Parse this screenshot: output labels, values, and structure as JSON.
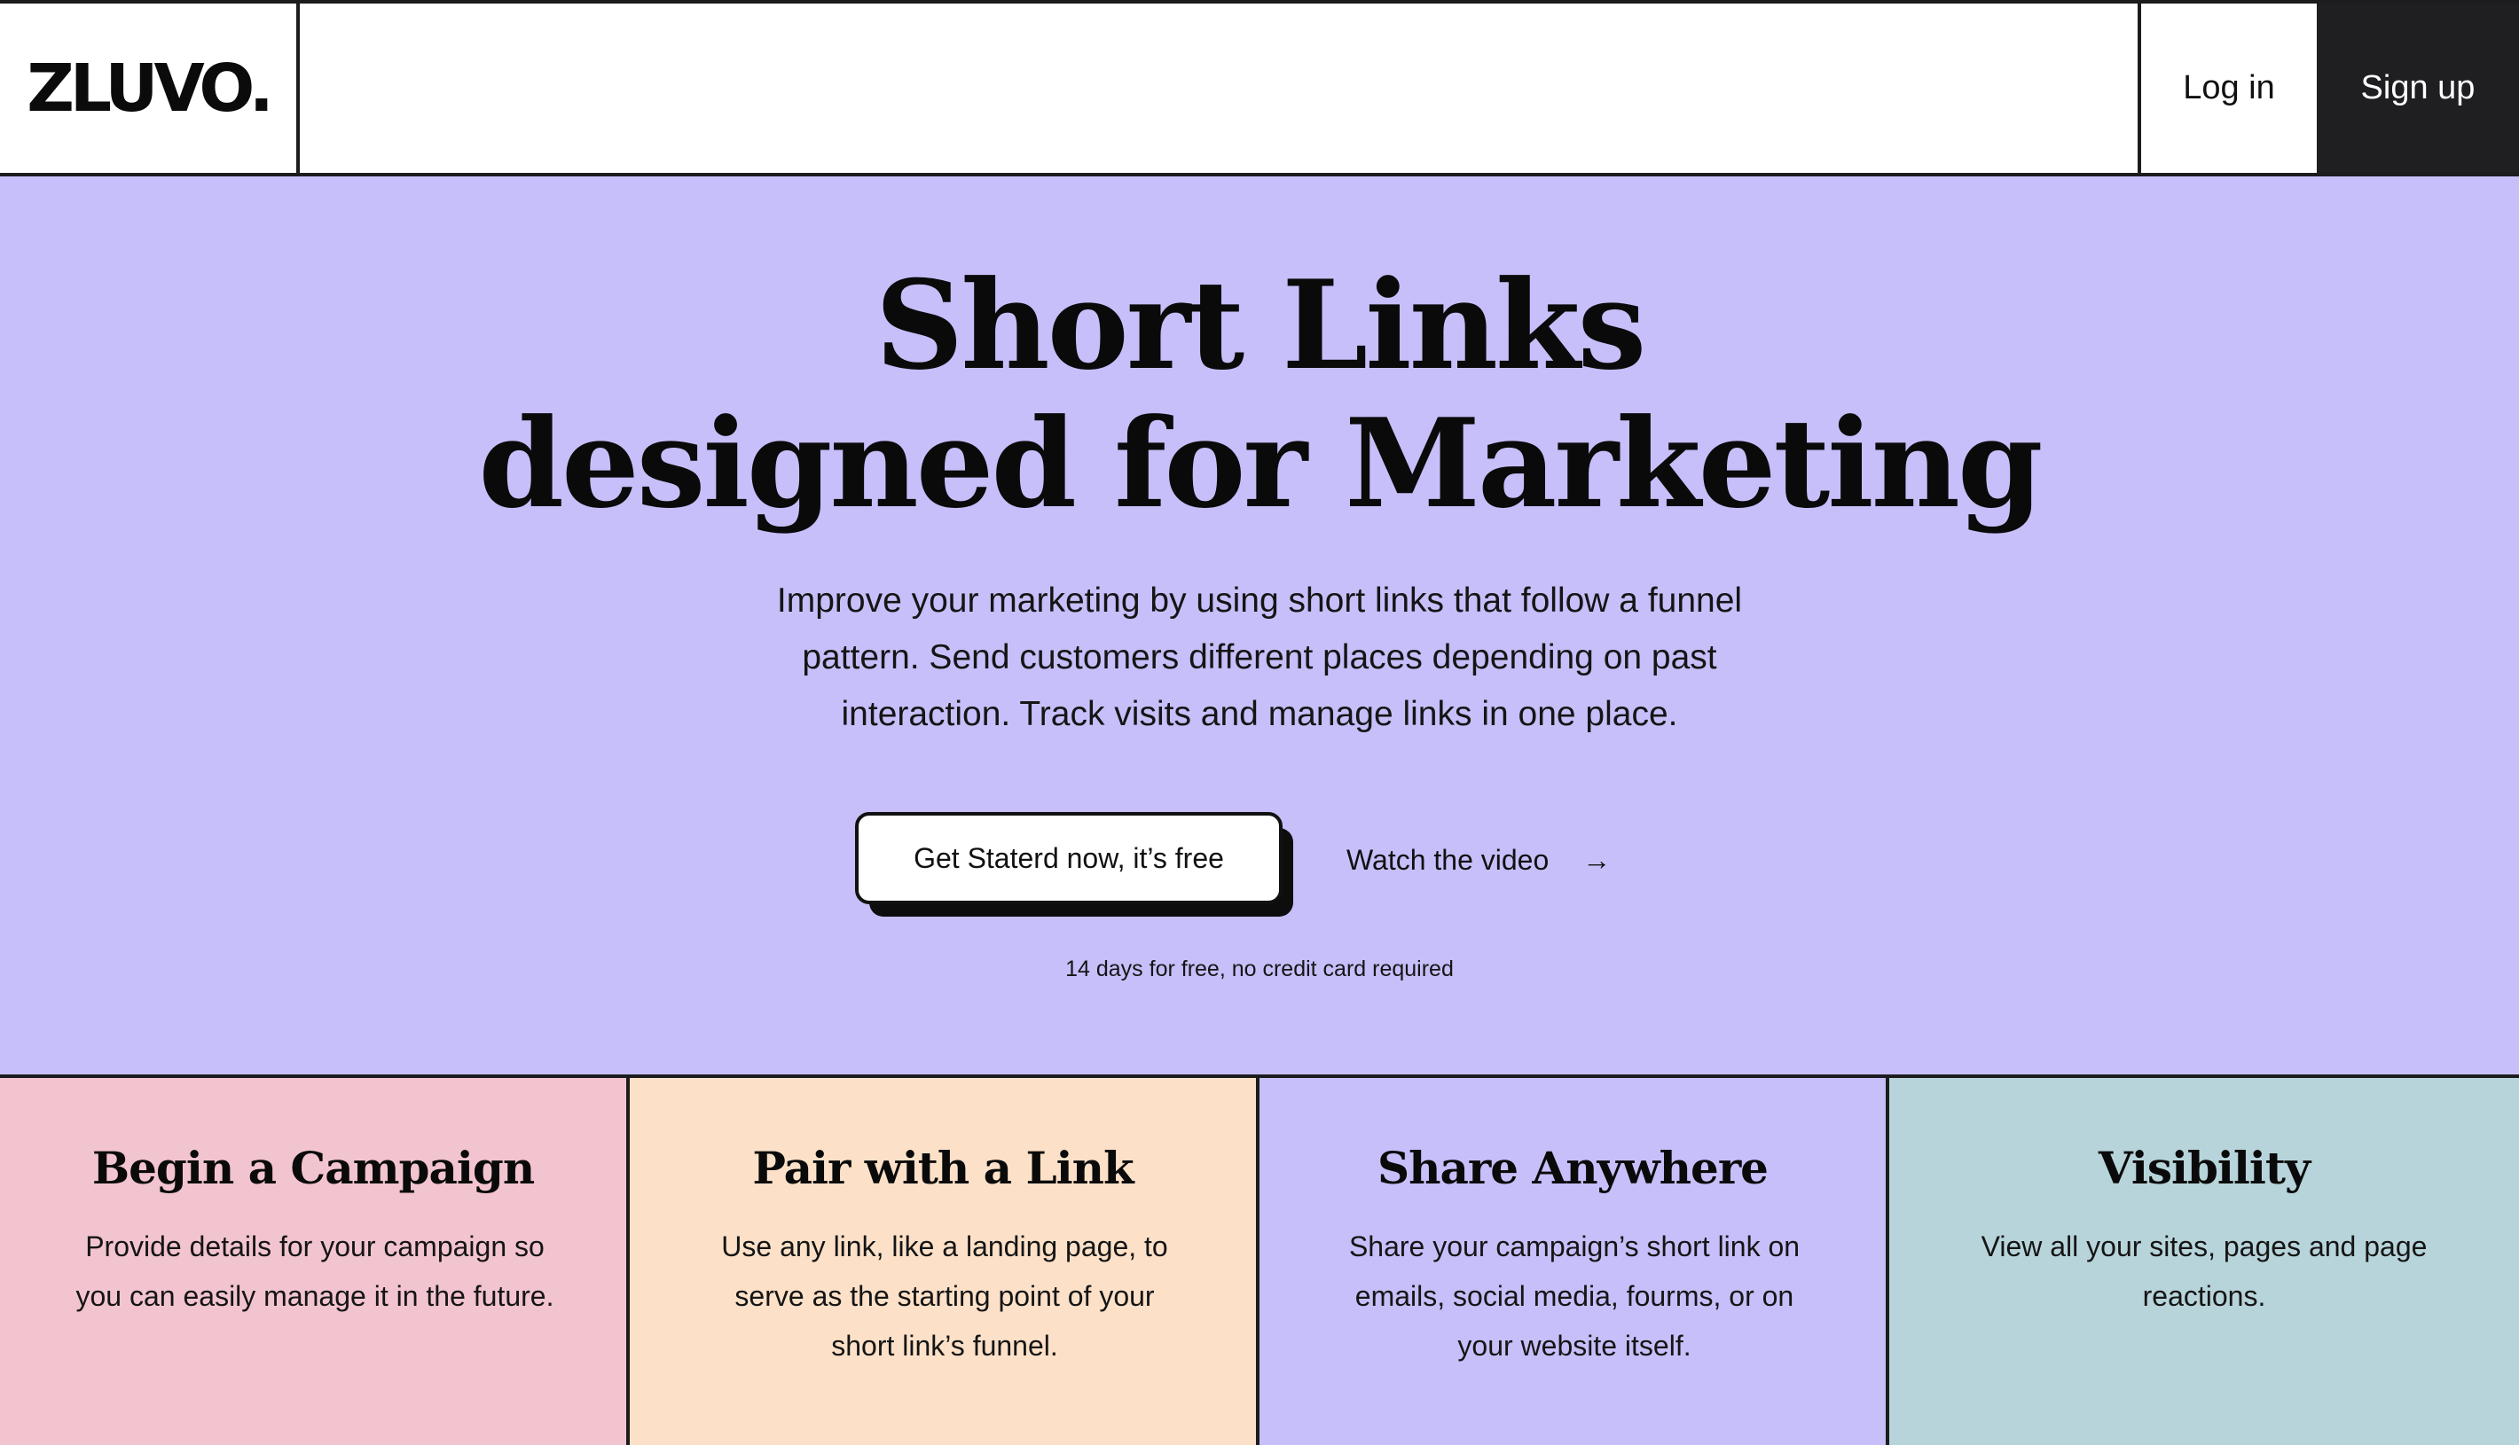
{
  "header": {
    "logo": "ZLUVO.",
    "login_label": "Log in",
    "signup_label": "Sign up"
  },
  "hero": {
    "title_line1": "Short Links",
    "title_line2": "designed for Marketing",
    "subtitle": "Improve your marketing by using short links that follow a funnel pattern. Send customers different places depending on past interaction. Track visits and manage links in one place.",
    "cta_label": "Get Staterd now, it’s free",
    "video_label": "Watch the video",
    "video_arrow": "→",
    "note": "14 days for free, no credit card required"
  },
  "features": [
    {
      "title": "Begin a Campaign",
      "description": "Provide details for your campaign so you can easily manage it in the future.",
      "color": "#f2c4cf"
    },
    {
      "title": "Pair with a Link",
      "description": "Use any link, like a landing page, to serve as the starting point of your short link’s funnel.",
      "color": "#fce1c8"
    },
    {
      "title": "Share Anywhere",
      "description": "Share your campaign’s short link on emails, social media, fourms, or on your website itself.",
      "color": "#c7bffa"
    },
    {
      "title": "Visibility",
      "description": "View all your sites, pages and page reactions.",
      "color": "#b7d4da"
    }
  ],
  "colors": {
    "hero_bg": "#c7bffa",
    "dark": "#1f1f22",
    "border": "#1c1c1e"
  },
  "icons": {
    "video_arrow": "arrow-right-icon"
  }
}
